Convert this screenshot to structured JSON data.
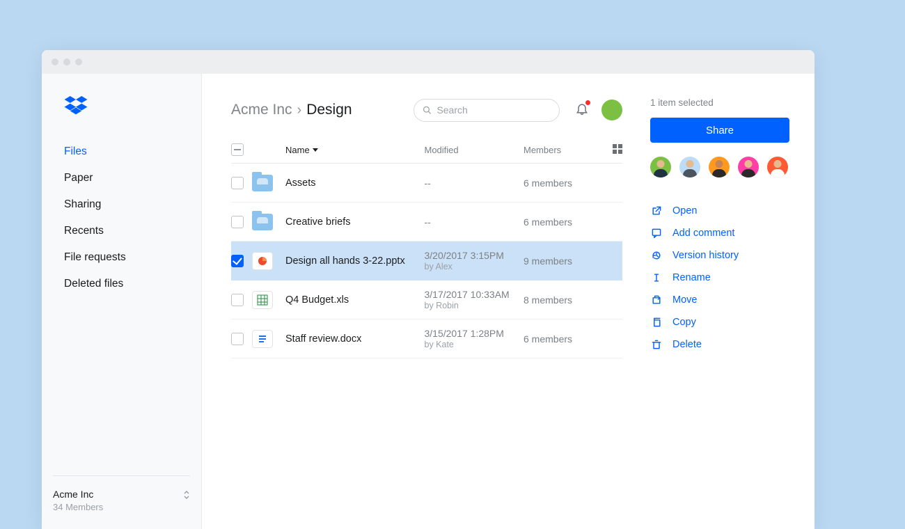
{
  "sidebar": {
    "items": [
      "Files",
      "Paper",
      "Sharing",
      "Recents",
      "File requests",
      "Deleted files"
    ],
    "active": 0,
    "team_name": "Acme Inc",
    "team_members": "34 Members"
  },
  "header": {
    "crumb_root": "Acme Inc",
    "crumb_sep": "›",
    "crumb_leaf": "Design",
    "search_placeholder": "Search"
  },
  "table": {
    "col_name": "Name",
    "col_modified": "Modified",
    "col_members": "Members",
    "rows": [
      {
        "type": "folder",
        "name": "Assets",
        "modified": "--",
        "by": "",
        "members": "6 members",
        "selected": false
      },
      {
        "type": "folder",
        "name": "Creative briefs",
        "modified": "--",
        "by": "",
        "members": "6 members",
        "selected": false
      },
      {
        "type": "ppt",
        "name": "Design all hands 3-22.pptx",
        "modified": "3/20/2017 3:15PM",
        "by": "by Alex",
        "members": "9 members",
        "selected": true
      },
      {
        "type": "xls",
        "name": "Q4 Budget.xls",
        "modified": "3/17/2017 10:33AM",
        "by": "by Robin",
        "members": "8 members",
        "selected": false
      },
      {
        "type": "doc",
        "name": "Staff review.docx",
        "modified": "3/15/2017 1:28PM",
        "by": "by Kate",
        "members": "6 members",
        "selected": false
      }
    ]
  },
  "panel": {
    "selected_text": "1 item selected",
    "share_label": "Share",
    "avatars": [
      {
        "bg": "#7bc043",
        "skin": "#e6b98f",
        "shirt": "#213245"
      },
      {
        "bg": "#bcdcf7",
        "skin": "#e6b98f",
        "shirt": "#4a5560"
      },
      {
        "bg": "#ff9a1f",
        "skin": "#c78456",
        "shirt": "#2a2a2a"
      },
      {
        "bg": "#ff3ea6",
        "skin": "#e6b98f",
        "shirt": "#2a2a2a"
      },
      {
        "bg": "#ff5a34",
        "skin": "#e6b98f",
        "shirt": "#ffffff"
      }
    ],
    "actions": [
      {
        "icon": "open",
        "label": "Open"
      },
      {
        "icon": "comment",
        "label": "Add comment"
      },
      {
        "icon": "history",
        "label": "Version history"
      },
      {
        "icon": "rename",
        "label": "Rename"
      },
      {
        "icon": "move",
        "label": "Move"
      },
      {
        "icon": "copy",
        "label": "Copy"
      },
      {
        "icon": "delete",
        "label": "Delete"
      }
    ]
  }
}
